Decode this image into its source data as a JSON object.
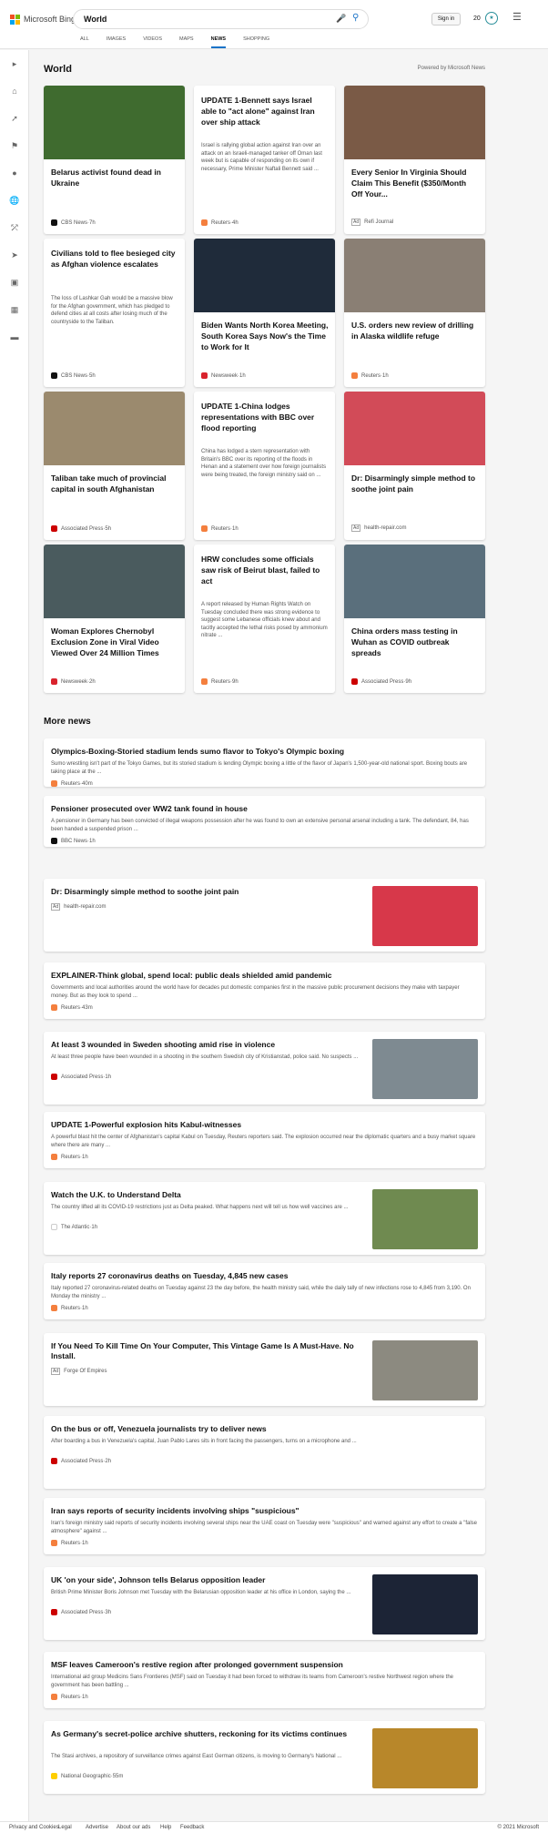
{
  "header": {
    "brand": "Microsoft Bing",
    "query": "World",
    "signin": "Sign in",
    "points": "20"
  },
  "tabs": [
    "ALL",
    "IMAGES",
    "VIDEOS",
    "MAPS",
    "NEWS",
    "SHOPPING"
  ],
  "section": {
    "title": "World",
    "powered": "Powered by Microsoft News"
  },
  "cards": [
    {
      "title": "Belarus activist found dead in Ukraine",
      "excerpt": "",
      "source": "CBS News",
      "time": "7h",
      "ad": false,
      "color": "#111"
    },
    {
      "title": "UPDATE 1-Bennett says Israel able to \"act alone\" against Iran over ship attack",
      "excerpt": "Israel is rallying global action against Iran over an attack on an Israeli-managed tanker off Oman last week but is capable of responding on its own if necessary, Prime Minister Naftali Bennett said ...",
      "source": "Reuters",
      "time": "4h",
      "ad": false,
      "color": "#f47f3e"
    },
    {
      "title": "Every Senior In Virginia Should Claim This Benefit ($350/Month Off Your...",
      "excerpt": "",
      "source": "Refi Journal",
      "time": "",
      "ad": true,
      "color": "#fff"
    },
    {
      "title": "Civilians told to flee besieged city as Afghan violence escalates",
      "excerpt": "The loss of Lashkar Gah would be a massive blow for the Afghan government, which has pledged to defend cities at all costs after losing much of the countryside to the Taliban.",
      "source": "CBS News",
      "time": "5h",
      "ad": false,
      "color": "#111"
    },
    {
      "title": "Biden Wants North Korea Meeting, South Korea Says Now's the Time to Work for It",
      "excerpt": "",
      "source": "Newsweek",
      "time": "1h",
      "ad": false,
      "color": "#d9232d"
    },
    {
      "title": "U.S. orders new review of drilling in Alaska wildlife refuge",
      "excerpt": "",
      "source": "Reuters",
      "time": "1h",
      "ad": false,
      "color": "#f47f3e"
    },
    {
      "title": "Taliban take much of provincial capital in south Afghanistan",
      "excerpt": "",
      "source": "Associated Press",
      "time": "5h",
      "ad": false,
      "color": "#c00"
    },
    {
      "title": "UPDATE 1-China lodges representations with BBC over flood reporting",
      "excerpt": "China has lodged a stern representation with Britain's BBC over its reporting of the floods in Henan and a statement over how foreign journalists were being treated, the foreign ministry said on ...",
      "source": "Reuters",
      "time": "1h",
      "ad": false,
      "color": "#f47f3e"
    },
    {
      "title": "Dr: Disarmingly simple method to soothe joint pain",
      "excerpt": "",
      "source": "health-repair.com",
      "time": "",
      "ad": true,
      "color": "#fff"
    },
    {
      "title": "Woman Explores Chernobyl Exclusion Zone in Viral Video Viewed Over 24 Million Times",
      "excerpt": "",
      "source": "Newsweek",
      "time": "2h",
      "ad": false,
      "color": "#d9232d"
    },
    {
      "title": "HRW concludes some officials saw risk of Beirut blast, failed to act",
      "excerpt": "A report released by Human Rights Watch on Tuesday concluded there was strong evidence to suggest some Lebanese officials knew about and tacitly accepted the lethal risks posed by ammonium nitrate ...",
      "source": "Reuters",
      "time": "9h",
      "ad": false,
      "color": "#f47f3e"
    },
    {
      "title": "China orders mass testing in Wuhan as COVID outbreak spreads",
      "excerpt": "",
      "source": "Associated Press",
      "time": "9h",
      "ad": false,
      "color": "#c00"
    }
  ],
  "more_title": "More news",
  "more": [
    {
      "title": "Olympics-Boxing-Storied stadium lends sumo flavor to Tokyo's Olympic boxing",
      "excerpt": "Sumo wrestling isn't part of the Tokyo Games, but its storied stadium is lending Olympic boxing a little of the flavor of Japan's 1,500-year-old national sport. Boxing bouts are taking place at the ...",
      "source": "Reuters",
      "time": "40m",
      "ad": false,
      "color": "#f47f3e"
    },
    {
      "title": "Pensioner prosecuted over WW2 tank found in house",
      "excerpt": "A pensioner in Germany has been convicted of illegal weapons possession after he was found to own an extensive personal arsenal including a tank. The defendant, 84, has been handed a suspended prison ...",
      "source": "BBC News",
      "time": "1h",
      "ad": false,
      "color": "#111"
    },
    {
      "title": "Dr: Disarmingly simple method to soothe joint pain",
      "excerpt": "",
      "source": "health-repair.com",
      "time": "",
      "ad": true,
      "color": "#fff"
    },
    {
      "title": "EXPLAINER-Think global, spend local: public deals shielded amid pandemic",
      "excerpt": "Governments and local authorities around the world have for decades put domestic companies first in the massive public procurement decisions they make with taxpayer money. But as they look to spend ...",
      "source": "Reuters",
      "time": "43m",
      "ad": false,
      "color": "#f47f3e"
    },
    {
      "title": "At least 3 wounded in Sweden shooting amid rise in violence",
      "excerpt": "At least three people have been wounded in a shooting in the southern Swedish city of Kristianstad, police said. No suspects ...",
      "source": "Associated Press",
      "time": "1h",
      "ad": false,
      "color": "#c00"
    },
    {
      "title": "UPDATE 1-Powerful explosion hits Kabul-witnesses",
      "excerpt": "A powerful blast hit the center of Afghanistan's capital Kabul on Tuesday, Reuters reporters said. The explosion occurred near the diplomatic quarters and a busy market square where there are many ...",
      "source": "Reuters",
      "time": "1h",
      "ad": false,
      "color": "#f47f3e"
    },
    {
      "title": "Watch the U.K. to Understand Delta",
      "excerpt": "The country lifted all its COVID-19 restrictions just as Delta peaked. What happens next will tell us how well vaccines are ...",
      "source": "The Atlantic",
      "time": "1h",
      "ad": false,
      "color": "#fff"
    },
    {
      "title": "Italy reports 27 coronavirus deaths on Tuesday, 4,845 new cases",
      "excerpt": "Italy reported 27 coronavirus-related deaths on Tuesday against 23 the day before, the health ministry said, while the daily tally of new infections rose to 4,845 from 3,190. On Monday the ministry ...",
      "source": "Reuters",
      "time": "1h",
      "ad": false,
      "color": "#f47f3e"
    },
    {
      "title": "If You Need To Kill Time On Your Computer, This Vintage Game Is A Must-Have. No Install.",
      "excerpt": "",
      "source": "Forge Of Empires",
      "time": "",
      "ad": true,
      "color": "#fff"
    },
    {
      "title": "On the bus or off, Venezuela journalists try to deliver news",
      "excerpt": "After boarding a bus in Venezuela's capital, Juan Pablo Lares sits in front facing the passengers, turns on a microphone and ...",
      "source": "Associated Press",
      "time": "2h",
      "ad": false,
      "color": "#c00"
    },
    {
      "title": "Iran says reports of security incidents involving ships \"suspicious\"",
      "excerpt": "Iran's foreign ministry said reports of security incidents involving several ships near the UAE coast on Tuesday were \"suspicious\" and warned against any effort to create a \"false atmosphere\" against ...",
      "source": "Reuters",
      "time": "1h",
      "ad": false,
      "color": "#f47f3e"
    },
    {
      "title": "UK 'on your side', Johnson tells Belarus opposition leader",
      "excerpt": "British Prime Minister Boris Johnson met Tuesday with the Belarusian opposition leader at his office in London, saying the ...",
      "source": "Associated Press",
      "time": "3h",
      "ad": false,
      "color": "#c00"
    },
    {
      "title": "MSF leaves Cameroon's restive region after prolonged government suspension",
      "excerpt": "International aid group Medicins Sans Frontieres (MSF) said on Tuesday it had been forced to withdraw its teams from Cameroon's restive Northwest region where the government has been battling ...",
      "source": "Reuters",
      "time": "1h",
      "ad": false,
      "color": "#f47f3e"
    },
    {
      "title": "As Germany's secret-police archive shutters, reckoning for its victims continues",
      "excerpt": "The Stasi archives, a repository of surveillance crimes against East German citizens, is moving to Germany's National ...",
      "source": "National Geographic",
      "time": "55m",
      "ad": false,
      "color": "#ffce00"
    }
  ],
  "footer": {
    "links": [
      "Privacy and Cookies",
      "Legal",
      "Advertise",
      "About our ads",
      "Help",
      "Feedback"
    ],
    "copyright": "© 2021 Microsoft"
  }
}
